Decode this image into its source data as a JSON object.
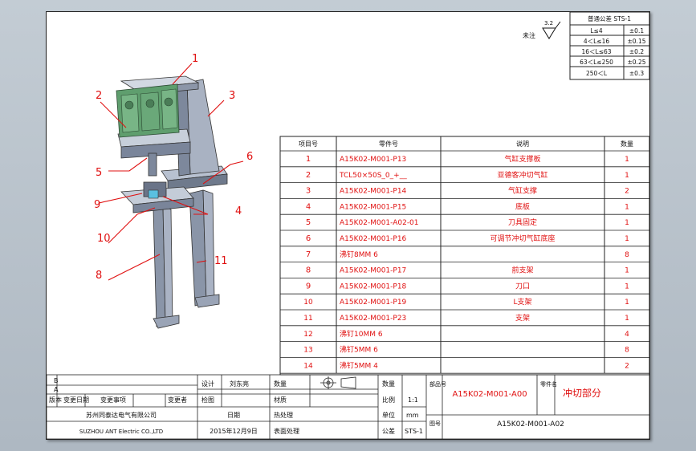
{
  "tolerance_table": {
    "header": "普通公差 STS-1",
    "rows": [
      {
        "range": "L≤4",
        "tol": "±0.1"
      },
      {
        "range": "4＜L≤16",
        "tol": "±0.15"
      },
      {
        "range": "16＜L≤63",
        "tol": "±0.2"
      },
      {
        "range": "63＜L≤250",
        "tol": "±0.25"
      },
      {
        "range": "250＜L",
        "tol": "±0.3"
      }
    ]
  },
  "surface_finish": {
    "label": "未注",
    "value": "3.2"
  },
  "callouts": [
    "1",
    "2",
    "3",
    "4",
    "5",
    "6",
    "8",
    "9",
    "10",
    "11"
  ],
  "bom": {
    "headers": {
      "no": "项目号",
      "part": "零件号",
      "desc": "说明",
      "qty": "数量"
    },
    "rows": [
      {
        "no": "1",
        "part": "A15K02-M001-P13",
        "desc": "气缸支撑板",
        "qty": "1"
      },
      {
        "no": "2",
        "part": "TCL50×50S_0_+__",
        "desc": "亚德客冲切气缸",
        "qty": "1"
      },
      {
        "no": "3",
        "part": "A15K02-M001-P14",
        "desc": "气缸支撑",
        "qty": "2"
      },
      {
        "no": "4",
        "part": "A15K02-M001-P15",
        "desc": "底板",
        "qty": "1"
      },
      {
        "no": "5",
        "part": "A15K02-M001-A02-01",
        "desc": "刀具固定",
        "qty": "1"
      },
      {
        "no": "6",
        "part": "A15K02-M001-P16",
        "desc": "可调节冲切气缸底座",
        "qty": "1"
      },
      {
        "no": "7",
        "part": "沸钉8MM 6",
        "desc": "",
        "qty": "8"
      },
      {
        "no": "8",
        "part": "A15K02-M001-P17",
        "desc": "前支架",
        "qty": "1"
      },
      {
        "no": "9",
        "part": "A15K02-M001-P18",
        "desc": "刀口",
        "qty": "1"
      },
      {
        "no": "10",
        "part": "A15K02-M001-P19",
        "desc": "L支架",
        "qty": "1"
      },
      {
        "no": "11",
        "part": "A15K02-M001-P23",
        "desc": "支架",
        "qty": "1"
      },
      {
        "no": "12",
        "part": "沸钉10MM 6",
        "desc": "",
        "qty": "4"
      },
      {
        "no": "13",
        "part": "沸钉5MM 6",
        "desc": "",
        "qty": "8"
      },
      {
        "no": "14",
        "part": "沸钉5MM 4",
        "desc": "",
        "qty": "2"
      }
    ]
  },
  "title_block": {
    "rev_b": "B",
    "rev_a": "A",
    "rev_header": "版本 变更日期  变更事项  变更者",
    "revision_cols": [
      "版本",
      "变更日期",
      "变更事项",
      "变更者"
    ],
    "design_label": "设计",
    "designer": "刘东亮",
    "check_label": "检图",
    "date_label": "日期",
    "date_value": "2015年12月9日",
    "company_cn": "苏州同泰达电气有限公司",
    "company_en": "SUZHOU ANT Electric CO.,LTD",
    "count_label": "数量",
    "material_label": "材质",
    "heat_label": "热处理",
    "surface_label": "表面处理",
    "scale_label": "比例",
    "scale_value": "1:1",
    "unit_label": "单位",
    "unit_value": "mm",
    "tolerance_label": "公差",
    "tolerance_value": "STS-1",
    "part_no_label": "部品号",
    "part_no_value": "A15K02-M001-A00",
    "part_name_label": "零件名",
    "part_name_value": "冲切部分",
    "drawing_no_label": "图号",
    "drawing_no_value": "A15K02-M001-A02"
  },
  "colors": {
    "red": "#e01010",
    "frame": "#222222",
    "bg": "#b9c2cb"
  }
}
